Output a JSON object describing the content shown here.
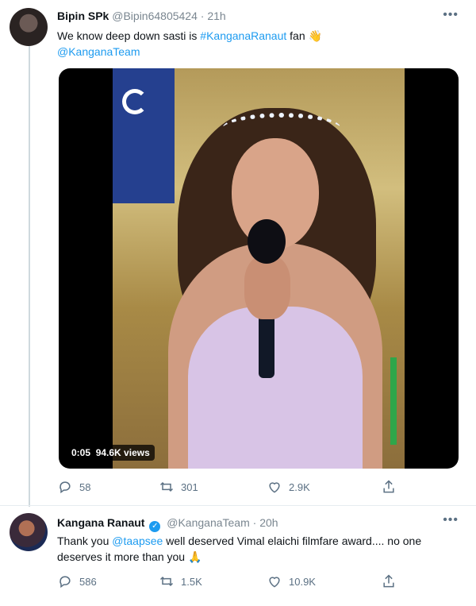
{
  "tweet1": {
    "author_name": "Bipin SPk",
    "handle": "@Bipin64805424",
    "separator": "·",
    "time": "21h",
    "text_plain": "We know deep down sasti is ",
    "hashtag": "#KanganaRanaut",
    "text_after": " fan",
    "emoji": "👋",
    "mention": "@KanganaTeam",
    "video_time": "0:05",
    "video_views": "94.6K views",
    "reply_count": "58",
    "retweet_count": "301",
    "like_count": "2.9K",
    "more_icon": "more-dots-icon"
  },
  "tweet2": {
    "author_name": "Kangana Ranaut",
    "verified_mark": "✓",
    "handle": "@KanganaTeam",
    "separator": "·",
    "time": "20h",
    "text_before": "Thank you ",
    "mention": "@taapsee",
    "text_after": " well deserved Vimal elaichi filmfare award.... no one deserves it more than you ",
    "emoji": "🙏",
    "reply_count": "586",
    "retweet_count": "1.5K",
    "like_count": "10.9K"
  },
  "colors": {
    "accent": "#1d9bf0",
    "muted": "#5b7083",
    "verified": "#1d9bf0"
  }
}
